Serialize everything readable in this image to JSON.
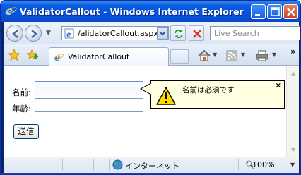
{
  "window": {
    "title": "ValidatorCallout - Windows Internet Explorer"
  },
  "nav": {
    "address": "/alidatorCallout.aspx",
    "search_placeholder": "Live Search"
  },
  "tabs": [
    {
      "label": "ValidatorCallout"
    }
  ],
  "form": {
    "name_label": "名前:",
    "age_label": "年齢:",
    "name_value": "",
    "age_value": "",
    "submit_label": "送信"
  },
  "callout": {
    "message": "名前は必須です",
    "close_label": "×"
  },
  "status": {
    "zone": "インターネット",
    "zoom": "100%"
  },
  "icons": {
    "title": "ie-icon",
    "warning": "warning-icon",
    "home": "home-icon",
    "feeds": "rss-icon",
    "print": "print-icon"
  },
  "colors": {
    "titlebar": "#0054e3",
    "callout_bg": "#ffffe1",
    "warning_yellow": "#ffd700"
  }
}
